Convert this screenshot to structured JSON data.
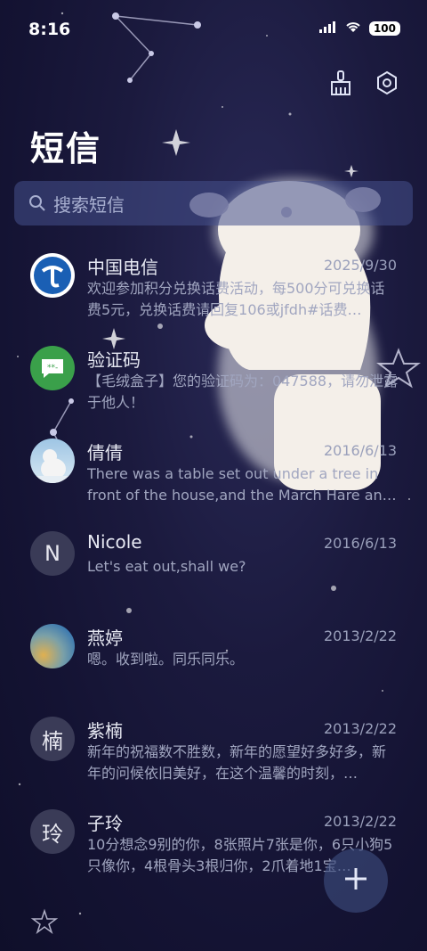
{
  "status": {
    "time": "8:16",
    "battery": "100"
  },
  "header": {
    "title": "短信"
  },
  "search": {
    "placeholder": "搜索短信"
  },
  "icons": {
    "clean": "broom-icon",
    "settings": "settings-icon",
    "search": "search-icon",
    "compose": "plus-icon"
  },
  "conversations": [
    {
      "name": "中国电信",
      "date": "2025/9/30",
      "preview": "欢迎参加积分兑换话费活动，每500分可兑换话费5元，兑换话费请回复106或jfdh#话费…",
      "avatar": "china-telecom-logo",
      "avatar_color": "#ffffff"
    },
    {
      "name": "验证码",
      "date": "",
      "preview": "【毛绒盒子】您的验证码为：047588，请勿泄露于他人！",
      "avatar": "message-icon",
      "avatar_color": "#3aa04a"
    },
    {
      "name": "倩倩",
      "date": "2016/6/13",
      "preview": "There was a table set out under a tree in front of the house,and the March Hare an…",
      "avatar": "polar-bear-photo",
      "avatar_color": "#8fb8d8"
    },
    {
      "name": "Nicole",
      "date": "2016/6/13",
      "preview": "Let's eat out,shall we?",
      "avatar": "N",
      "avatar_color": "#3a3b57"
    },
    {
      "name": "燕婷",
      "date": "2013/2/22",
      "preview": "嗯。收到啦。同乐同乐。",
      "avatar": "colorful-photo",
      "avatar_color": "#5a8fb0"
    },
    {
      "name": "紫楠",
      "date": "2013/2/22",
      "preview": "新年的祝福数不胜数，新年的愿望好多好多，新年的问候依旧美好，在这个温馨的时刻，…",
      "avatar": "楠",
      "avatar_color": "#3a3b57"
    },
    {
      "name": "子玲",
      "date": "2013/2/22",
      "preview": "10分想念9别的你，8张照片7张是你，6只小狗5只像你，4根骨头3根归你，2爪着地1宝…",
      "avatar": "玲",
      "avatar_color": "#3a3b57"
    }
  ]
}
